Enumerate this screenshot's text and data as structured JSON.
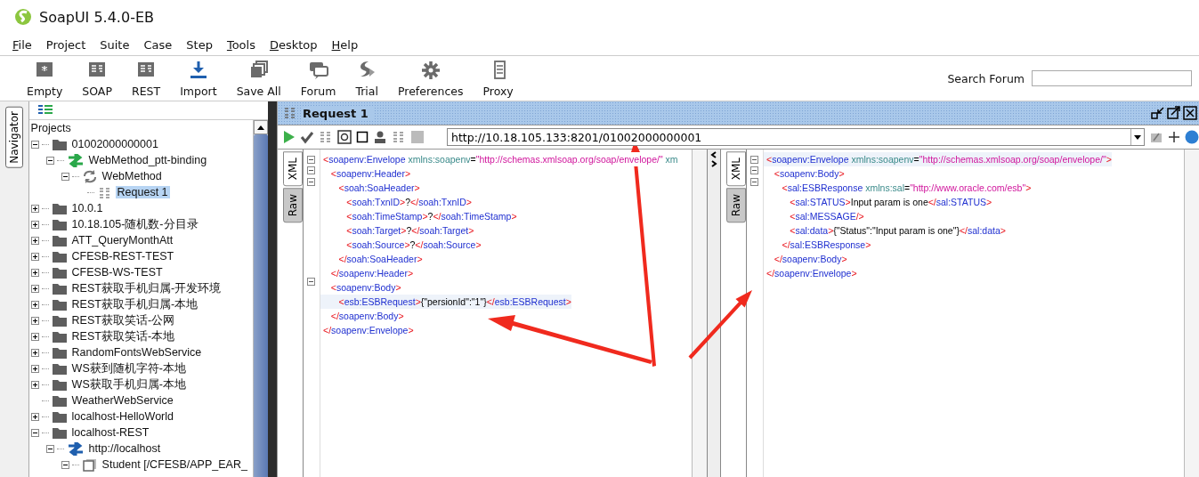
{
  "window": {
    "title": "SoapUI 5.4.0-EB"
  },
  "menu": [
    {
      "label": "File",
      "underlined": true
    },
    {
      "label": "Project",
      "underlined": false
    },
    {
      "label": "Suite",
      "underlined": false
    },
    {
      "label": "Case",
      "underlined": false
    },
    {
      "label": "Step",
      "underlined": false
    },
    {
      "label": "Tools",
      "underlined": true
    },
    {
      "label": "Desktop",
      "underlined": true
    },
    {
      "label": "Help",
      "underlined": true
    }
  ],
  "toolbar": [
    {
      "label": "Empty",
      "kind": "empty"
    },
    {
      "label": "SOAP",
      "kind": "soap"
    },
    {
      "label": "REST",
      "kind": "rest"
    },
    {
      "label": "Import",
      "kind": "import"
    },
    {
      "label": "Save All",
      "kind": "saveall"
    },
    {
      "label": "Forum",
      "kind": "forum"
    },
    {
      "label": "Trial",
      "kind": "trial"
    },
    {
      "label": "Preferences",
      "kind": "gear"
    },
    {
      "label": "Proxy",
      "kind": "proxy"
    }
  ],
  "search": {
    "label": "Search Forum"
  },
  "navigator": {
    "label": "Navigator"
  },
  "tree": {
    "root": "Projects",
    "items": [
      {
        "label": "01002000000001",
        "kind": "folder",
        "expanded": true,
        "selected": false,
        "children": [
          {
            "label": "WebMethod_ptt-binding",
            "kind": "interface",
            "expanded": true,
            "selected": false,
            "children": [
              {
                "label": "WebMethod",
                "kind": "operation",
                "expanded": true,
                "selected": false,
                "children": [
                  {
                    "label": "Request 1",
                    "kind": "request",
                    "selected": true
                  }
                ]
              }
            ]
          }
        ]
      },
      {
        "label": "10.0.1",
        "kind": "folder",
        "expanded": false,
        "selected": false
      },
      {
        "label": "10.18.105-随机数-分目录",
        "kind": "folder",
        "expanded": false,
        "selected": false
      },
      {
        "label": "ATT_QueryMonthAtt",
        "kind": "folder",
        "expanded": false,
        "selected": false
      },
      {
        "label": "CFESB-REST-TEST",
        "kind": "folder",
        "expanded": false,
        "selected": false
      },
      {
        "label": "CFESB-WS-TEST",
        "kind": "folder",
        "expanded": false,
        "selected": false
      },
      {
        "label": "REST获取手机归属-开发环境",
        "kind": "folder",
        "expanded": false,
        "selected": false
      },
      {
        "label": "REST获取手机归属-本地",
        "kind": "folder",
        "expanded": false,
        "selected": false
      },
      {
        "label": "REST获取笑话-公网",
        "kind": "folder",
        "expanded": false,
        "selected": false
      },
      {
        "label": "REST获取笑话-本地",
        "kind": "folder",
        "expanded": false,
        "selected": false
      },
      {
        "label": "RandomFontsWebService",
        "kind": "folder",
        "expanded": false,
        "selected": false
      },
      {
        "label": "WS获到随机字符-本地",
        "kind": "folder",
        "expanded": false,
        "selected": false
      },
      {
        "label": "WS获取手机归属-本地",
        "kind": "folder",
        "expanded": false,
        "selected": false
      },
      {
        "label": "WeatherWebService",
        "kind": "folder",
        "selected": false
      },
      {
        "label": "localhost-HelloWorld",
        "kind": "folder",
        "expanded": false,
        "selected": false
      },
      {
        "label": "localhost-REST",
        "kind": "folder",
        "expanded": true,
        "selected": false,
        "children": [
          {
            "label": "http://localhost",
            "kind": "rest-interface",
            "expanded": true,
            "selected": false,
            "children": [
              {
                "label": "Student [/CFESB/APP_EAR_",
                "kind": "resource",
                "expanded": true,
                "selected": false
              }
            ]
          }
        ]
      }
    ]
  },
  "request": {
    "title": "Request 1",
    "url": "http://10.18.105.133:8201/01002000000001",
    "request_tabs": [
      {
        "label": "XML",
        "selected": true
      },
      {
        "label": "Raw",
        "selected": false
      }
    ],
    "request_lines": [
      {
        "text": "<soapenv:Envelope xmlns:soapenv=\"http://schemas.xmlsoap.org/soap/envelope/\" xm",
        "fold": true,
        "highlighted": false
      },
      {
        "text": "   <soapenv:Header>",
        "fold": true,
        "highlighted": false
      },
      {
        "text": "      <soah:SoaHeader>",
        "fold": true,
        "highlighted": false
      },
      {
        "text": "         <soah:TxnID>?</soah:TxnID>",
        "fold": false,
        "highlighted": false
      },
      {
        "text": "         <soah:TimeStamp>?</soah:TimeStamp>",
        "fold": false,
        "highlighted": false
      },
      {
        "text": "         <soah:Target>?</soah:Target>",
        "fold": false,
        "highlighted": false
      },
      {
        "text": "         <soah:Source>?</soah:Source>",
        "fold": false,
        "highlighted": false
      },
      {
        "text": "      </soah:SoaHeader>",
        "fold": false,
        "highlighted": false
      },
      {
        "text": "   </soapenv:Header>",
        "fold": false,
        "highlighted": false
      },
      {
        "text": "   <soapenv:Body>",
        "fold": true,
        "highlighted": false
      },
      {
        "text": "      <esb:ESBRequest>{\"persionId\":\"1\"}</esb:ESBRequest>",
        "fold": false,
        "highlighted": true
      },
      {
        "text": "   </soapenv:Body>",
        "fold": false,
        "highlighted": false
      },
      {
        "text": "</soapenv:Envelope>",
        "fold": false,
        "highlighted": false
      }
    ],
    "response_tabs": [
      {
        "label": "XML",
        "selected": true
      },
      {
        "label": "Raw",
        "selected": false
      }
    ],
    "response_lines": [
      {
        "text": "<soapenv:Envelope xmlns:soapenv=\"http://schemas.xmlsoap.org/soap/envelope/\">",
        "fold": true,
        "highlighted": true
      },
      {
        "text": "   <soapenv:Body>",
        "fold": true,
        "highlighted": false
      },
      {
        "text": "      <sal:ESBResponse xmlns:sal=\"http://www.oracle.com/esb\">",
        "fold": true,
        "highlighted": false
      },
      {
        "text": "         <sal:STATUS>Input param is one</sal:STATUS>",
        "fold": false,
        "highlighted": false
      },
      {
        "text": "         <sal:MESSAGE/>",
        "fold": false,
        "highlighted": false
      },
      {
        "text": "         <sal:data>{\"Status\":\"Input param is one\"}</sal:data>",
        "fold": false,
        "highlighted": false
      },
      {
        "text": "      </sal:ESBResponse>",
        "fold": false,
        "highlighted": false
      },
      {
        "text": "   </soapenv:Body>",
        "fold": false,
        "highlighted": false
      },
      {
        "text": "</soapenv:Envelope>",
        "fold": false,
        "highlighted": false
      }
    ]
  }
}
